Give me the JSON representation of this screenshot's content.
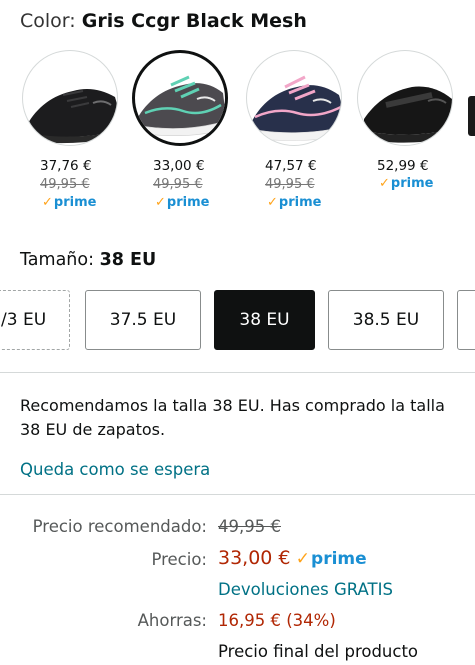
{
  "color": {
    "label": "Color:",
    "value": "Gris Ccgr Black Mesh"
  },
  "swatches": [
    {
      "price": "37,76 €",
      "old_price": "49,95 €",
      "prime": "prime",
      "selected": false
    },
    {
      "price": "33,00 €",
      "old_price": "49,95 €",
      "prime": "prime",
      "selected": true
    },
    {
      "price": "47,57 €",
      "old_price": "49,95 €",
      "prime": "prime",
      "selected": false
    },
    {
      "price": "52,99 €",
      "old_price": "",
      "prime": "prime",
      "selected": false
    }
  ],
  "size": {
    "label": "Tamaño:",
    "value": "38 EU",
    "options": [
      "/3 EU",
      "37.5 EU",
      "38 EU",
      "38.5 EU"
    ],
    "selected": "38 EU"
  },
  "recommendation": "Recomendamos la talla 38 EU. Has comprado la talla 38 EU de zapatos.",
  "waitlist_link": "Queda como se espera",
  "pricing": {
    "rrp_label": "Precio recomendado:",
    "rrp_value": "49,95 €",
    "price_label": "Precio:",
    "price_value": "33,00 €",
    "prime": "prime",
    "returns": "Devoluciones GRATIS",
    "savings_label": "Ahorras:",
    "savings_value": "16,95 € (34%)",
    "final_note": "Precio final del producto"
  },
  "colors": {
    "link": "#007185",
    "price_red": "#b12704",
    "prime_blue": "#1a8fd3",
    "check_orange": "#ffa41c"
  }
}
